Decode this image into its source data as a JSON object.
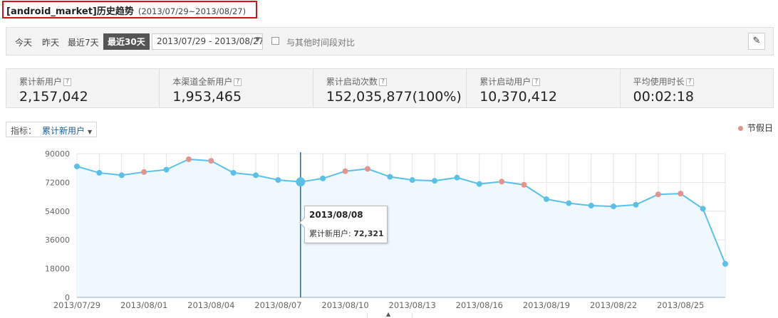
{
  "header": {
    "app_name": "[android_market]",
    "title_suffix": "历史趋势",
    "date_range": "(2013/07/29~2013/08/27)"
  },
  "toolbar": {
    "today": "今天",
    "yesterday": "昨天",
    "last7": "最近7天",
    "last30": "最近30天",
    "date_input": "2013/07/29 - 2013/08/27",
    "compare_label": "与其他时间段对比",
    "pin_icon": "pin-icon"
  },
  "stats": [
    {
      "label": "累计新用户",
      "value": "2,157,042"
    },
    {
      "label": "本渠道全新用户",
      "value": "1,953,465"
    },
    {
      "label": "累计启动次数",
      "value": "152,035,877(100%)"
    },
    {
      "label": "累计启动用户",
      "value": "10,370,412"
    },
    {
      "label": "平均使用时长",
      "value": "00:02:18"
    }
  ],
  "help_glyph": "?",
  "metric": {
    "label": "指标：",
    "value": "累计新用户"
  },
  "legend": {
    "holiday": "节假日"
  },
  "tooltip": {
    "date": "2013/08/08",
    "label": "累计新用户:",
    "value": "72,321"
  },
  "colors": {
    "line": "#5bc0e8",
    "area": "#eef8fd",
    "holiday_point": "#e2958e",
    "crosshair": "#1c6bb0",
    "title_border": "#d0141a"
  },
  "chart_data": {
    "type": "area",
    "title": "",
    "xlabel": "",
    "ylabel": "",
    "ylim": [
      0,
      90000
    ],
    "yticks": [
      0,
      18000,
      36000,
      54000,
      72000,
      90000
    ],
    "xtick_labels": [
      "2013/07/29",
      "2013/08/01",
      "2013/08/04",
      "2013/08/07",
      "2013/08/10",
      "2013/08/13",
      "2013/08/16",
      "2013/08/19",
      "2013/08/22",
      "2013/08/25"
    ],
    "x": [
      "2013/07/29",
      "2013/07/30",
      "2013/07/31",
      "2013/08/01",
      "2013/08/02",
      "2013/08/03",
      "2013/08/04",
      "2013/08/05",
      "2013/08/06",
      "2013/08/07",
      "2013/08/08",
      "2013/08/09",
      "2013/08/10",
      "2013/08/11",
      "2013/08/12",
      "2013/08/13",
      "2013/08/14",
      "2013/08/15",
      "2013/08/16",
      "2013/08/17",
      "2013/08/18",
      "2013/08/19",
      "2013/08/20",
      "2013/08/21",
      "2013/08/22",
      "2013/08/23",
      "2013/08/24",
      "2013/08/25",
      "2013/08/26",
      "2013/08/27"
    ],
    "series": [
      {
        "name": "累计新用户",
        "values": [
          82000,
          78000,
          76500,
          78500,
          80000,
          86500,
          85500,
          78000,
          76500,
          73500,
          72321,
          74500,
          79000,
          80500,
          75500,
          73500,
          73000,
          75000,
          71000,
          72500,
          70500,
          61500,
          59000,
          57500,
          57000,
          58000,
          64500,
          65000,
          55500,
          21000
        ]
      }
    ],
    "holidays": [
      "2013/08/01",
      "2013/08/03",
      "2013/08/04",
      "2013/08/10",
      "2013/08/11",
      "2013/08/17",
      "2013/08/18",
      "2013/08/24",
      "2013/08/25"
    ],
    "highlight": "2013/08/08",
    "grid": true,
    "legend": "top-right"
  }
}
